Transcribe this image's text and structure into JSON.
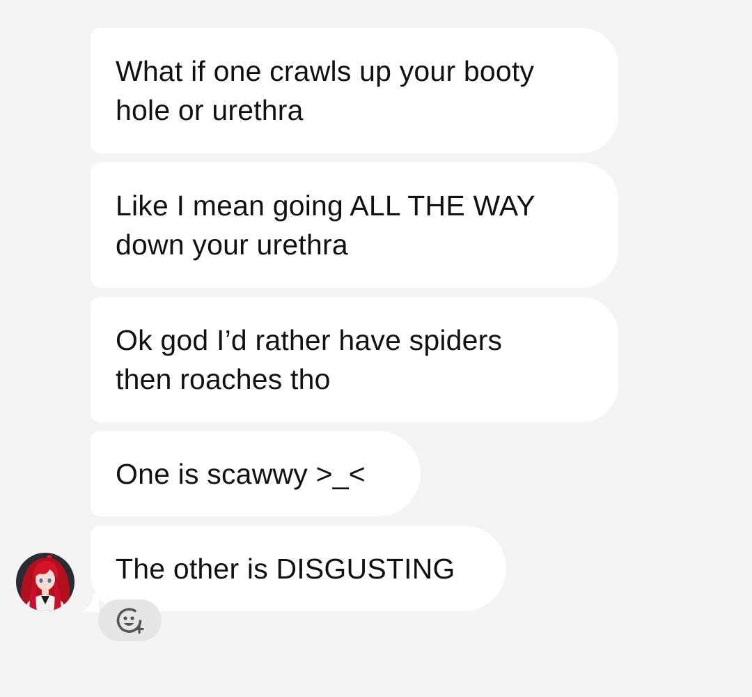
{
  "messages": [
    {
      "text": "What if one crawls up your booty\nhole or urethra"
    },
    {
      "text": "Like I mean going ALL THE WAY\ndown your urethra"
    },
    {
      "text": "Ok god I’d rather have spiders\nthen roaches tho"
    },
    {
      "text": "One is scawwy >_<"
    },
    {
      "text": "The other is DISGUSTING"
    }
  ],
  "icons": {
    "avatar": "anime-avatar-red-hair",
    "reaction": "add-reaction-smiley-icon"
  },
  "colors": {
    "background": "#f4f4f4",
    "bubble": "#ffffff",
    "text": "#111111",
    "reaction_button": "#e6e6e6",
    "reaction_icon": "#555555",
    "avatar_hair": "#c8102e"
  }
}
